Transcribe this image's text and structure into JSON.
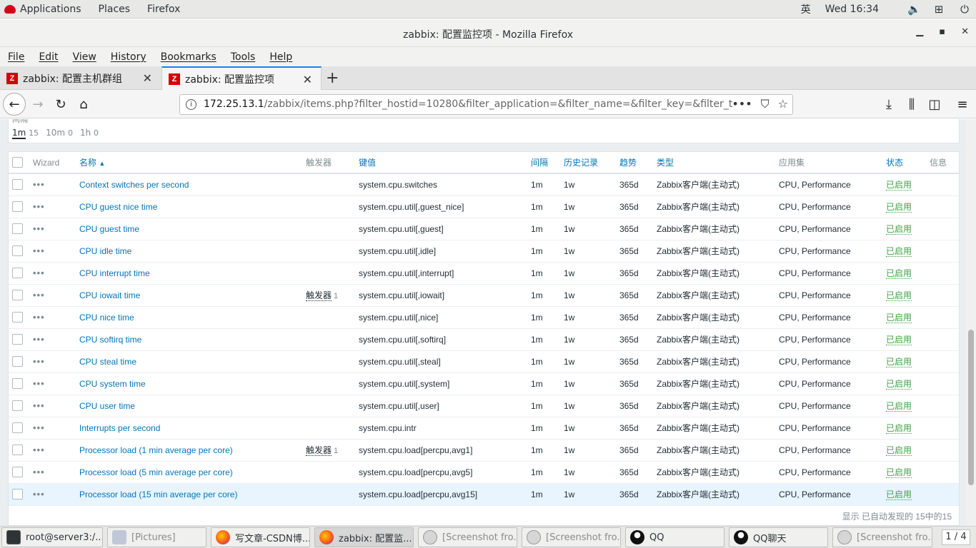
{
  "topbar": {
    "applications": "Applications",
    "places": "Places",
    "firefox": "Firefox",
    "input_method": "英",
    "clock": "Wed 16:34"
  },
  "window": {
    "title": "zabbix: 配置监控项 - Mozilla Firefox"
  },
  "menubar": [
    "File",
    "Edit",
    "View",
    "History",
    "Bookmarks",
    "Tools",
    "Help"
  ],
  "tabs": [
    {
      "label": "zabbix: 配置主机群组"
    },
    {
      "label": "zabbix: 配置监控项"
    }
  ],
  "urlbar": {
    "host": "172.25.13.1",
    "path": "/zabbix/items.php?filter_hostid=10280&filter_application=&filter_name=&filter_key=&filter_type="
  },
  "filter": {
    "cut_label": "间隔",
    "intervals": [
      {
        "label": "1m",
        "count": "15"
      },
      {
        "label": "10m",
        "count": "0"
      },
      {
        "label": "1h",
        "count": "0"
      }
    ]
  },
  "table": {
    "headers": {
      "wizard": "Wizard",
      "name": "名称",
      "triggers": "触发器",
      "key": "键值",
      "interval": "间隔",
      "history": "历史记录",
      "trends": "趋势",
      "type": "类型",
      "applications": "应用集",
      "status": "状态",
      "info": "信息"
    },
    "rows": [
      {
        "name": "Context switches per second",
        "trigger": "",
        "trigger_count": "",
        "key": "system.cpu.switches",
        "interval": "1m",
        "history": "1w",
        "trends": "365d",
        "type": "Zabbix客户端(主动式)",
        "apps": "CPU, Performance",
        "status": "已启用"
      },
      {
        "name": "CPU guest nice time",
        "trigger": "",
        "trigger_count": "",
        "key": "system.cpu.util[,guest_nice]",
        "interval": "1m",
        "history": "1w",
        "trends": "365d",
        "type": "Zabbix客户端(主动式)",
        "apps": "CPU, Performance",
        "status": "已启用"
      },
      {
        "name": "CPU guest time",
        "trigger": "",
        "trigger_count": "",
        "key": "system.cpu.util[,guest]",
        "interval": "1m",
        "history": "1w",
        "trends": "365d",
        "type": "Zabbix客户端(主动式)",
        "apps": "CPU, Performance",
        "status": "已启用"
      },
      {
        "name": "CPU idle time",
        "trigger": "",
        "trigger_count": "",
        "key": "system.cpu.util[,idle]",
        "interval": "1m",
        "history": "1w",
        "trends": "365d",
        "type": "Zabbix客户端(主动式)",
        "apps": "CPU, Performance",
        "status": "已启用"
      },
      {
        "name": "CPU interrupt time",
        "trigger": "",
        "trigger_count": "",
        "key": "system.cpu.util[,interrupt]",
        "interval": "1m",
        "history": "1w",
        "trends": "365d",
        "type": "Zabbix客户端(主动式)",
        "apps": "CPU, Performance",
        "status": "已启用"
      },
      {
        "name": "CPU iowait time",
        "trigger": "触发器",
        "trigger_count": "1",
        "key": "system.cpu.util[,iowait]",
        "interval": "1m",
        "history": "1w",
        "trends": "365d",
        "type": "Zabbix客户端(主动式)",
        "apps": "CPU, Performance",
        "status": "已启用"
      },
      {
        "name": "CPU nice time",
        "trigger": "",
        "trigger_count": "",
        "key": "system.cpu.util[,nice]",
        "interval": "1m",
        "history": "1w",
        "trends": "365d",
        "type": "Zabbix客户端(主动式)",
        "apps": "CPU, Performance",
        "status": "已启用"
      },
      {
        "name": "CPU softirq time",
        "trigger": "",
        "trigger_count": "",
        "key": "system.cpu.util[,softirq]",
        "interval": "1m",
        "history": "1w",
        "trends": "365d",
        "type": "Zabbix客户端(主动式)",
        "apps": "CPU, Performance",
        "status": "已启用"
      },
      {
        "name": "CPU steal time",
        "trigger": "",
        "trigger_count": "",
        "key": "system.cpu.util[,steal]",
        "interval": "1m",
        "history": "1w",
        "trends": "365d",
        "type": "Zabbix客户端(主动式)",
        "apps": "CPU, Performance",
        "status": "已启用"
      },
      {
        "name": "CPU system time",
        "trigger": "",
        "trigger_count": "",
        "key": "system.cpu.util[,system]",
        "interval": "1m",
        "history": "1w",
        "trends": "365d",
        "type": "Zabbix客户端(主动式)",
        "apps": "CPU, Performance",
        "status": "已启用"
      },
      {
        "name": "CPU user time",
        "trigger": "",
        "trigger_count": "",
        "key": "system.cpu.util[,user]",
        "interval": "1m",
        "history": "1w",
        "trends": "365d",
        "type": "Zabbix客户端(主动式)",
        "apps": "CPU, Performance",
        "status": "已启用"
      },
      {
        "name": "Interrupts per second",
        "trigger": "",
        "trigger_count": "",
        "key": "system.cpu.intr",
        "interval": "1m",
        "history": "1w",
        "trends": "365d",
        "type": "Zabbix客户端(主动式)",
        "apps": "CPU, Performance",
        "status": "已启用"
      },
      {
        "name": "Processor load (1 min average per core)",
        "trigger": "触发器",
        "trigger_count": "1",
        "key": "system.cpu.load[percpu,avg1]",
        "interval": "1m",
        "history": "1w",
        "trends": "365d",
        "type": "Zabbix客户端(主动式)",
        "apps": "CPU, Performance",
        "status": "已启用"
      },
      {
        "name": "Processor load (5 min average per core)",
        "trigger": "",
        "trigger_count": "",
        "key": "system.cpu.load[percpu,avg5]",
        "interval": "1m",
        "history": "1w",
        "trends": "365d",
        "type": "Zabbix客户端(主动式)",
        "apps": "CPU, Performance",
        "status": "已启用"
      },
      {
        "name": "Processor load (15 min average per core)",
        "trigger": "",
        "trigger_count": "",
        "key": "system.cpu.load[percpu,avg15]",
        "interval": "1m",
        "history": "1w",
        "trends": "365d",
        "type": "Zabbix客户端(主动式)",
        "apps": "CPU, Performance",
        "status": "已启用"
      }
    ],
    "footer": "显示 已自动发现的 15中的15"
  },
  "taskbar": {
    "items": [
      {
        "label": "root@server3:/...",
        "icon": "terminal-icon"
      },
      {
        "label": "[Pictures]",
        "icon": "folder-icon"
      },
      {
        "label": "写文章-CSDN博...",
        "icon": "firefox-icon"
      },
      {
        "label": "zabbix: 配置监...",
        "icon": "firefox-icon"
      },
      {
        "label": "[Screenshot fro...",
        "icon": "screenshot-icon"
      },
      {
        "label": "[Screenshot fro...",
        "icon": "screenshot-icon"
      },
      {
        "label": "QQ",
        "icon": "qq-icon"
      },
      {
        "label": "QQ聊天",
        "icon": "qq-icon"
      },
      {
        "label": "[Screenshot fro...",
        "icon": "screenshot-icon"
      }
    ],
    "workspace": "1 / 4"
  },
  "colors": {
    "link": "#0275b8",
    "enabled": "#429e47",
    "trigger_icon_red": "#d40000",
    "tab_active_accent": "#0a84ff"
  }
}
